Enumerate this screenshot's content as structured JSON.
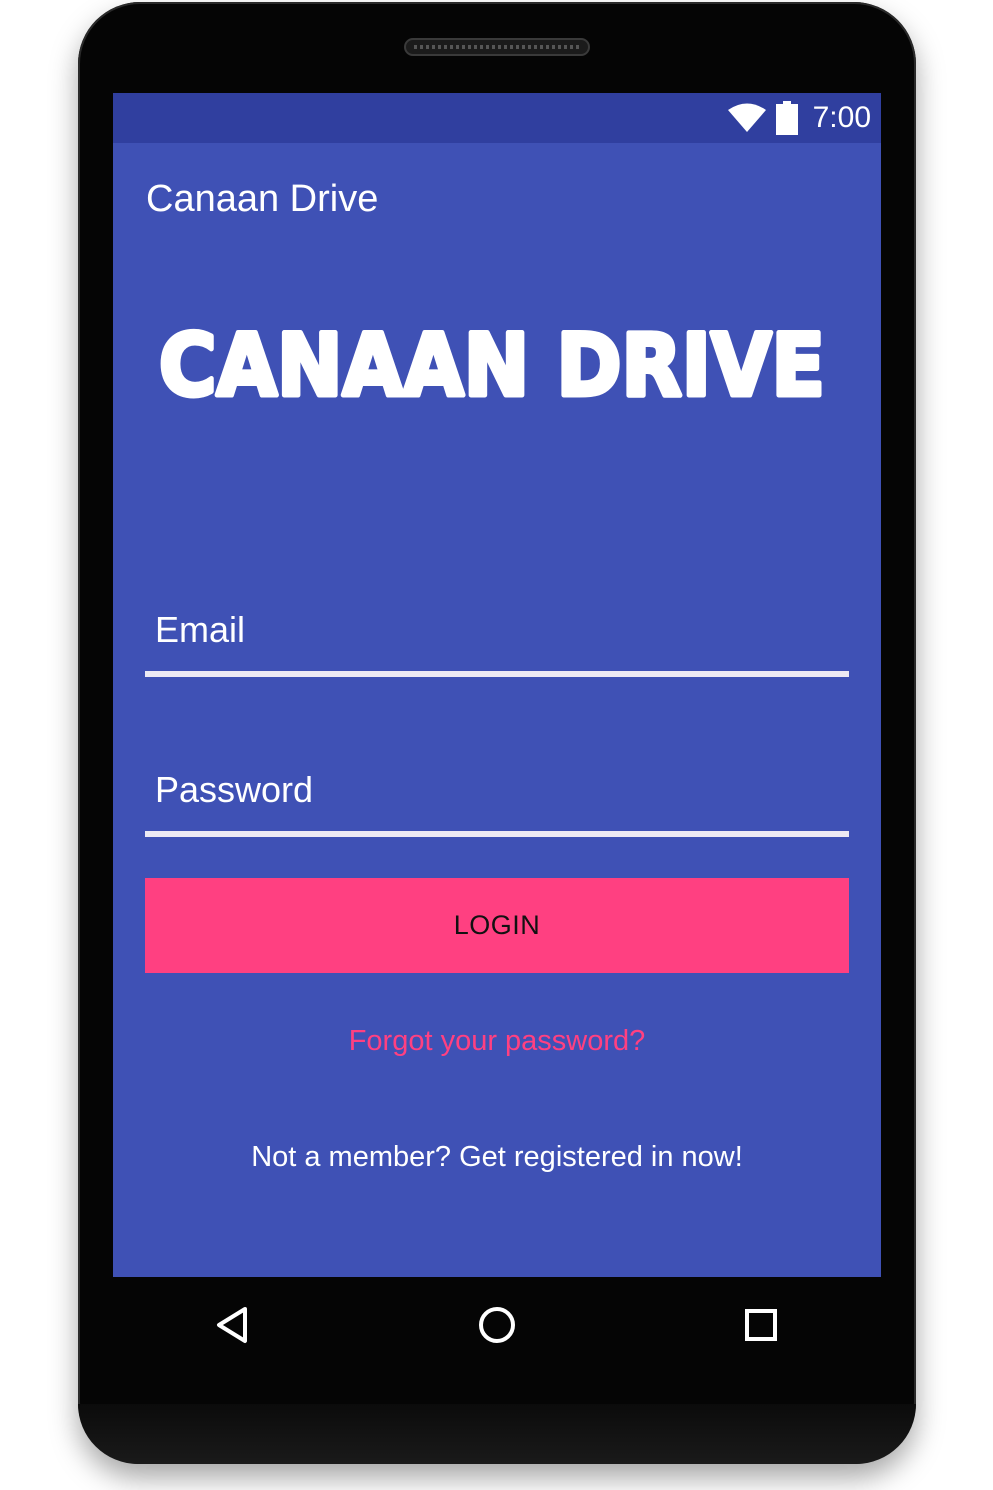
{
  "status_bar": {
    "time": "7:00",
    "icons": [
      "wifi-icon",
      "battery-icon"
    ]
  },
  "app_bar": {
    "title": "Canaan Drive"
  },
  "logo": {
    "text": "CANAAN DRIVE"
  },
  "form": {
    "email_placeholder": "Email",
    "email_value": "",
    "password_placeholder": "Password",
    "password_value": "",
    "login_label": "LOGIN",
    "forgot_label": "Forgot your password?",
    "register_label": "Not a member? Get registered in now!"
  },
  "nav_bar": {
    "icons": [
      "back-icon",
      "home-icon",
      "recents-icon"
    ]
  },
  "colors": {
    "primary": "#3F51B5",
    "primary_dark": "#303F9F",
    "accent": "#FF4081",
    "underline": "#ECEAF4"
  }
}
